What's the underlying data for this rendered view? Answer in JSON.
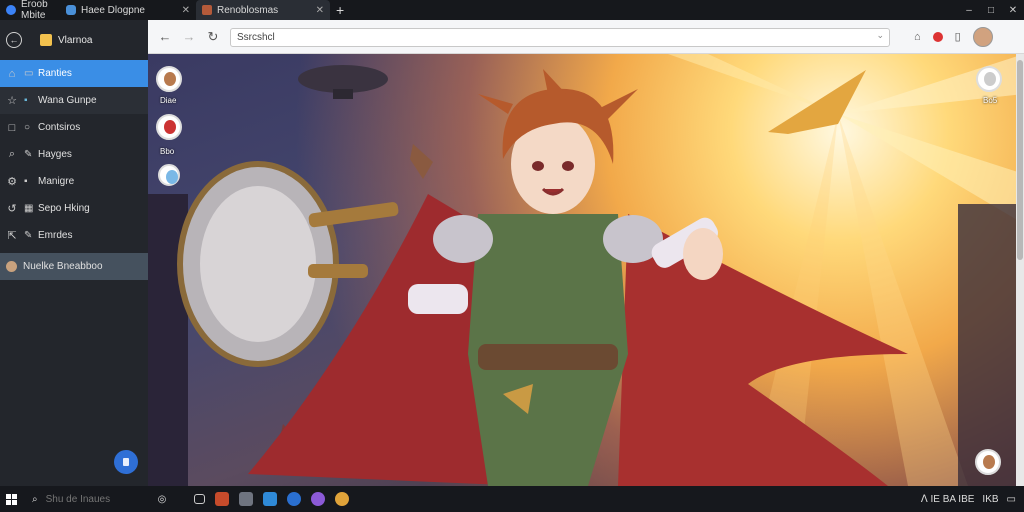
{
  "tabs": [
    {
      "label": "Eroob Mbite",
      "icon": "browser-logo-icon"
    },
    {
      "label": "Haee Dlogpne",
      "icon": "app-logo-icon"
    },
    {
      "label": "Renoblosmas",
      "icon": "avatar-favicon-icon"
    }
  ],
  "window_controls": {
    "minimize": "–",
    "maximize": "□",
    "close": "✕"
  },
  "sidebar": {
    "title": "Vlarnoa",
    "items": [
      {
        "label": "Ranties",
        "selected": true
      },
      {
        "label": "Wana Gunpe"
      },
      {
        "label": "Contsiros"
      },
      {
        "label": "Hayges"
      },
      {
        "label": "Manigre"
      },
      {
        "label": "Sepo Hking"
      },
      {
        "label": "Emrdes"
      },
      {
        "label": "Nuelke Bneabboo",
        "highlight": true
      }
    ]
  },
  "address_bar": {
    "value": "Ssrcshcl"
  },
  "favorites": [
    {
      "label": "Diae"
    },
    {
      "label": "Bbo"
    },
    {
      "label": ""
    },
    {
      "label": "Bo5"
    }
  ],
  "taskbar": {
    "search_placeholder": "Shu de Inaues",
    "tray_text": "ᐱ ΙΕ ΒΑ ΙΒΕ",
    "clock": "ΙΚΒ",
    "accent_blue": "#3a8ee6"
  }
}
